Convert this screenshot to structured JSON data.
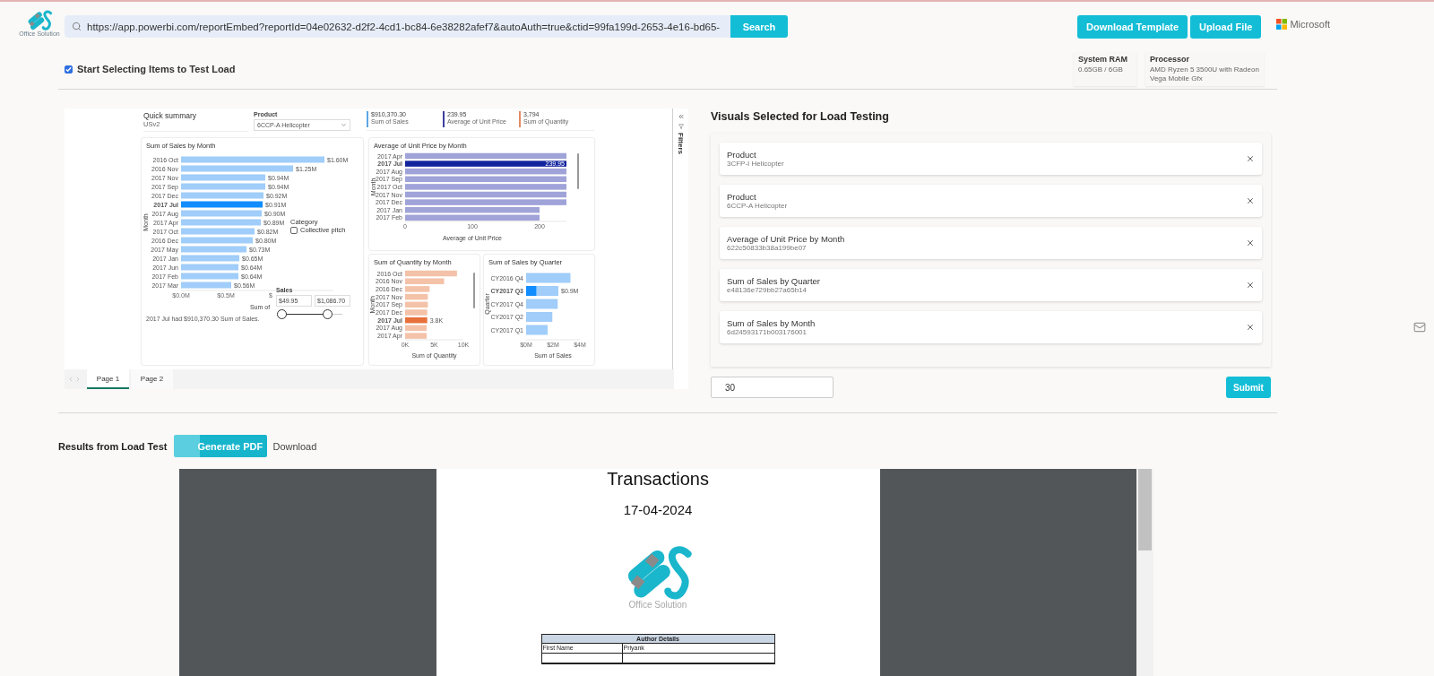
{
  "header": {
    "logo_caption": "Office Solution",
    "url": "https://app.powerbi.com/reportEmbed?reportId=04e02632-d2f2-4cd1-bc84-6e38282afef7&autoAuth=true&ctid=99fa199d-2653-4e16-bd65-",
    "search_button": "Search",
    "buttons": [
      "Download Template",
      "Upload File"
    ],
    "brand": "Microsoft"
  },
  "select_toggle": {
    "label": "Start Selecting Items to Test Load",
    "checked": true
  },
  "system_info": [
    {
      "label": "System RAM",
      "value": "0.65GB / 6GB"
    },
    {
      "label": "Processor",
      "value": "AMD Ryzen 5 3500U with Radeon Vega Mobile Gfx"
    }
  ],
  "report": {
    "summary": {
      "title": "Quick summary",
      "subtitle": "USv2"
    },
    "product_slicer": {
      "label": "Product",
      "value": "6CCP-A Helicopter"
    },
    "kpis": [
      {
        "value": "$910,370.30",
        "label": "Sum of Sales",
        "color": "#5aa6e6"
      },
      {
        "value": "239.95",
        "label": "Average of Unit Price",
        "color": "#3b3f9f"
      },
      {
        "value": "3,794",
        "label": "Sum of Quantity",
        "color": "#e08a63"
      }
    ],
    "sales_by_month": {
      "chart_data": {
        "type": "bar",
        "orientation": "horizontal",
        "title": "Sum of Sales by Month",
        "xlabel": "Sum of",
        "ylabel": "Month",
        "categories": [
          "2016 Oct",
          "2016 Nov",
          "2017 Nov",
          "2017 Sep",
          "2017 Dec",
          "2017 Jul",
          "2017 Aug",
          "2017 Apr",
          "2017 Oct",
          "2016 Dec",
          "2017 May",
          "2017 Jan",
          "2017 Jun",
          "2017 Feb",
          "2017 Mar"
        ],
        "series": [
          {
            "color": "#a0cdf9",
            "values": [
              1.6,
              1.25,
              0.94,
              0.94,
              0.92,
              null,
              0.9,
              0.89,
              0.82,
              0.8,
              0.73,
              0.65,
              0.64,
              0.64,
              0.56
            ]
          },
          {
            "color": "#118dff",
            "values": [
              null,
              null,
              null,
              null,
              null,
              0.91,
              null,
              null,
              null,
              null,
              null,
              null,
              null,
              null,
              null
            ]
          }
        ],
        "xlim": [
          0,
          1.7
        ],
        "xticks": [
          {
            "value": 0,
            "label": "$0.0M"
          },
          {
            "value": 0.5,
            "label": "$0.5M"
          },
          {
            "value": 1,
            "label": "$"
          }
        ],
        "value_labels": [
          "$1.60M",
          "$1.25M",
          "$0.94M",
          "$0.94M",
          "$0.92M",
          "$0.91M",
          "$0.90M",
          "$0.89M",
          "$0.82M",
          "$0.80M",
          "$0.73M",
          "$0.65M",
          "$0.64M",
          "$0.64M",
          "$0.56M"
        ]
      },
      "footer": "2017 Jul had $910,370.30 Sum of Sales."
    },
    "category_slicer": {
      "title": "Category",
      "options": [
        {
          "label": "Collective pitch",
          "checked": false
        }
      ]
    },
    "sales_slider": {
      "title": "Sales",
      "min": "$49.95",
      "max": "$1,086.70",
      "thumbs": [
        {
          "level": 0
        },
        {
          "level": 0.75
        }
      ]
    },
    "unit_price_by_month": {
      "chart_data": {
        "type": "bar",
        "orientation": "horizontal",
        "title": "Average of Unit Price by Month",
        "xlabel": "Average of Unit Price",
        "ylabel": "Month",
        "categories": [
          "2017 Apr",
          "2017 Jul",
          "2017 Aug",
          "2017 Sep",
          "2017 Oct",
          "2017 Nov",
          "2017 Dec",
          "2017 Jan",
          "2017 Feb"
        ],
        "series": [
          {
            "color": "#a0a3d8",
            "values": [
              240,
              null,
              240,
              240,
              240,
              240,
              240,
              200,
              200
            ]
          },
          {
            "color": "#12239e",
            "values": [
              null,
              240,
              null,
              null,
              null,
              null,
              null,
              null,
              null
            ]
          }
        ],
        "xlim": [
          0,
          240
        ],
        "xticks": [
          0,
          100,
          200
        ],
        "value_labels": [
          null,
          "239.95",
          null,
          null,
          null,
          null,
          null,
          null,
          null
        ]
      }
    },
    "quantity_by_month": {
      "chart_data": {
        "type": "bar",
        "orientation": "horizontal",
        "title": "Sum of Quantity by Month",
        "xlabel": "Sum of Quantity",
        "ylabel": "Month",
        "categories": [
          "2016 Oct",
          "2016 Nov",
          "2016 Dec",
          "2017 Nov",
          "2017 Sep",
          "2017 Dec",
          "2017 Jul",
          "2017 Aug",
          "2017 Apr"
        ],
        "series": [
          {
            "color": "#f4c2a8",
            "values": [
              8.9,
              6.7,
              4.2,
              3.9,
              3.9,
              3.8,
              null,
              3.7,
              3.7
            ]
          },
          {
            "color": "#e8703a",
            "values": [
              null,
              null,
              null,
              null,
              null,
              null,
              3.8,
              null,
              null
            ]
          }
        ],
        "xlim": [
          0,
          10
        ],
        "xticks": [
          {
            "value": 0,
            "label": "0K"
          },
          {
            "value": 5,
            "label": "5K"
          },
          {
            "value": 10,
            "label": "10K"
          }
        ],
        "value_labels": [
          null,
          null,
          null,
          null,
          null,
          null,
          "3.8K",
          null,
          null
        ]
      }
    },
    "sales_by_quarter": {
      "chart_data": {
        "type": "bar",
        "orientation": "horizontal",
        "title": "Sum of Sales by Quarter",
        "xlabel": "Sum of Sales",
        "ylabel": "Quarter",
        "categories": [
          "CY2016 Q4",
          "CY2017 Q3",
          "CY2017 Q4",
          "CY2017 Q2",
          "CY2017 Q1"
        ],
        "stacked": true,
        "series": [
          {
            "color": "#118dff",
            "values": [
              null,
              0.77,
              null,
              null,
              null
            ]
          },
          {
            "color": "#a0cdf9",
            "values": [
              3.3,
              1.63,
              2.35,
              1.95,
              1.6
            ]
          }
        ],
        "xlim": [
          0,
          4
        ],
        "xticks": [
          {
            "value": 0,
            "label": "$0M"
          },
          {
            "value": 2,
            "label": "$2M"
          },
          {
            "value": 4,
            "label": "$4M"
          }
        ],
        "value_labels": [
          null,
          "$0.9M",
          null,
          null,
          null
        ]
      }
    },
    "filters_label": "Filters",
    "pages": [
      {
        "label": "Page 1",
        "selected": true
      },
      {
        "label": "Page 2",
        "selected": false
      }
    ]
  },
  "visuals_panel": {
    "title": "Visuals Selected for Load Testing",
    "items": [
      {
        "name": "Product",
        "id": "3CFP-I Helicopter"
      },
      {
        "name": "Product",
        "id": "6CCP-A Helicopter"
      },
      {
        "name": "Average of Unit Price by Month",
        "id": "622c50833b38a199be07"
      },
      {
        "name": "Sum of Sales by Quarter",
        "id": "e48136e729bb27a65b14"
      },
      {
        "name": "Sum of Sales by Month",
        "id": "6d24593171b003176001"
      }
    ],
    "count_input": "30",
    "submit": "Submit"
  },
  "results": {
    "title": "Results from Load Test",
    "generate_button": "Generate PDF",
    "download_link": "Download",
    "pdf": {
      "title": "Transactions",
      "date": "17-04-2024",
      "logo_caption": "Office Solution",
      "table": {
        "title": "Author Details",
        "rows": [
          [
            "First Name",
            "Priyank"
          ]
        ]
      }
    }
  }
}
